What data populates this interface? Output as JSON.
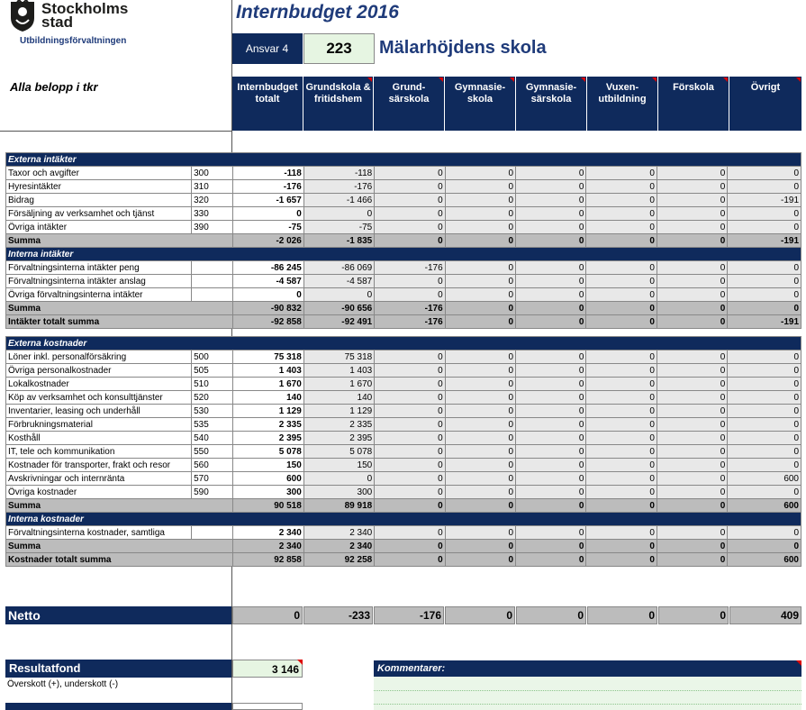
{
  "logo": {
    "name_line1": "Stockholms",
    "name_line2": "stad",
    "department": "Utbildningsförvaltningen"
  },
  "title": "Internbudget 2016",
  "ansvar": {
    "label": "Ansvar 4",
    "value": "223",
    "school": "Mälarhöjdens skola"
  },
  "amounts_note": "Alla belopp i tkr",
  "columns": [
    "Internbudget totalt",
    "Grundskola & fritidshem",
    "Grund- särskola",
    "Gymnasie- skola",
    "Gymnasie- särskola",
    "Vuxen- utbildning",
    "Förskola",
    "Övrigt"
  ],
  "sections": [
    {
      "title": "Externa intäkter",
      "rows": [
        {
          "label": "Taxor och avgifter",
          "code": "300",
          "values": [
            "-118",
            "-118",
            "0",
            "0",
            "0",
            "0",
            "0",
            "0"
          ]
        },
        {
          "label": "Hyresintäkter",
          "code": "310",
          "values": [
            "-176",
            "-176",
            "0",
            "0",
            "0",
            "0",
            "0",
            "0"
          ]
        },
        {
          "label": "Bidrag",
          "code": "320",
          "values": [
            "-1 657",
            "-1 466",
            "0",
            "0",
            "0",
            "0",
            "0",
            "-191"
          ]
        },
        {
          "label": "Försäljning av verksamhet och tjänst",
          "code": "330",
          "values": [
            "0",
            "0",
            "0",
            "0",
            "0",
            "0",
            "0",
            "0"
          ]
        },
        {
          "label": "Övriga intäkter",
          "code": "390",
          "values": [
            "-75",
            "-75",
            "0",
            "0",
            "0",
            "0",
            "0",
            "0"
          ]
        }
      ],
      "sum": {
        "label": "Summa",
        "values": [
          "-2 026",
          "-1 835",
          "0",
          "0",
          "0",
          "0",
          "0",
          "-191"
        ]
      }
    },
    {
      "title": "Interna intäkter",
      "rows": [
        {
          "label": "Förvaltningsinterna intäkter peng",
          "code": "",
          "values": [
            "-86 245",
            "-86 069",
            "-176",
            "0",
            "0",
            "0",
            "0",
            "0"
          ]
        },
        {
          "label": "Förvaltningsinterna intäkter anslag",
          "code": "",
          "values": [
            "-4 587",
            "-4 587",
            "0",
            "0",
            "0",
            "0",
            "0",
            "0"
          ]
        },
        {
          "label": "Övriga förvaltningsinterna intäkter",
          "code": "",
          "values": [
            "0",
            "0",
            "0",
            "0",
            "0",
            "0",
            "0",
            "0"
          ]
        }
      ],
      "sum": {
        "label": "Summa",
        "values": [
          "-90 832",
          "-90 656",
          "-176",
          "0",
          "0",
          "0",
          "0",
          "0"
        ]
      }
    }
  ],
  "income_total": {
    "label": "Intäkter totalt summa",
    "values": [
      "-92 858",
      "-92 491",
      "-176",
      "0",
      "0",
      "0",
      "0",
      "-191"
    ]
  },
  "cost_sections": [
    {
      "title": "Externa kostnader",
      "rows": [
        {
          "label": "Löner inkl. personalförsäkring",
          "code": "500",
          "values": [
            "75 318",
            "75 318",
            "0",
            "0",
            "0",
            "0",
            "0",
            "0"
          ]
        },
        {
          "label": "Övriga personalkostnader",
          "code": "505",
          "values": [
            "1 403",
            "1 403",
            "0",
            "0",
            "0",
            "0",
            "0",
            "0"
          ]
        },
        {
          "label": "Lokalkostnader",
          "code": "510",
          "values": [
            "1 670",
            "1 670",
            "0",
            "0",
            "0",
            "0",
            "0",
            "0"
          ]
        },
        {
          "label": "Köp av verksamhet och konsulttjänster",
          "code": "520",
          "values": [
            "140",
            "140",
            "0",
            "0",
            "0",
            "0",
            "0",
            "0"
          ]
        },
        {
          "label": "Inventarier, leasing och underhåll",
          "code": "530",
          "values": [
            "1 129",
            "1 129",
            "0",
            "0",
            "0",
            "0",
            "0",
            "0"
          ]
        },
        {
          "label": "Förbrukningsmaterial",
          "code": "535",
          "values": [
            "2 335",
            "2 335",
            "0",
            "0",
            "0",
            "0",
            "0",
            "0"
          ]
        },
        {
          "label": "Kosthåll",
          "code": "540",
          "values": [
            "2 395",
            "2 395",
            "0",
            "0",
            "0",
            "0",
            "0",
            "0"
          ]
        },
        {
          "label": "IT, tele och kommunikation",
          "code": "550",
          "values": [
            "5 078",
            "5 078",
            "0",
            "0",
            "0",
            "0",
            "0",
            "0"
          ]
        },
        {
          "label": "Kostnader för transporter, frakt och resor",
          "code": "560",
          "values": [
            "150",
            "150",
            "0",
            "0",
            "0",
            "0",
            "0",
            "0"
          ]
        },
        {
          "label": "Avskrivningar och internränta",
          "code": "570",
          "values": [
            "600",
            "0",
            "0",
            "0",
            "0",
            "0",
            "0",
            "600"
          ]
        },
        {
          "label": "Övriga kostnader",
          "code": "590",
          "values": [
            "300",
            "300",
            "0",
            "0",
            "0",
            "0",
            "0",
            "0"
          ]
        }
      ],
      "sum": {
        "label": "Summa",
        "values": [
          "90 518",
          "89 918",
          "0",
          "0",
          "0",
          "0",
          "0",
          "600"
        ]
      }
    },
    {
      "title": "Interna kostnader",
      "rows": [
        {
          "label": "Förvaltningsinterna kostnader, samtliga",
          "code": "",
          "values": [
            "2 340",
            "2 340",
            "0",
            "0",
            "0",
            "0",
            "0",
            "0"
          ]
        }
      ],
      "sum": {
        "label": "Summa",
        "values": [
          "2 340",
          "2 340",
          "0",
          "0",
          "0",
          "0",
          "0",
          "0"
        ]
      }
    }
  ],
  "cost_total": {
    "label": "Kostnader totalt summa",
    "values": [
      "92 858",
      "92 258",
      "0",
      "0",
      "0",
      "0",
      "0",
      "600"
    ]
  },
  "netto": {
    "label": "Netto",
    "values": [
      "0",
      "-233",
      "-176",
      "0",
      "0",
      "0",
      "0",
      "409"
    ]
  },
  "resultatfond": {
    "label": "Resultatfond",
    "value": "3 146",
    "note": "Överskott (+), underskott (-)"
  },
  "kommentarer": {
    "label": "Kommentarer:"
  },
  "colors": {
    "navy": "#0f2a5c",
    "input_green": "#e6f5e2",
    "sum_grey": "#bcbcbc"
  }
}
